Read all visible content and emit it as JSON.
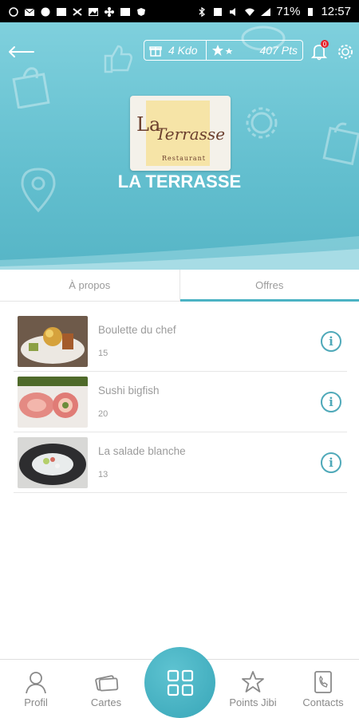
{
  "status_bar": {
    "battery": "71%",
    "time": "12:57"
  },
  "header": {
    "kdo": "4 Kdo",
    "points": "407 Pts",
    "notification_count": "0",
    "shop_name": "LA TERRASSE",
    "logo": {
      "line1": "La",
      "line2": "Terrasse",
      "line3": "Restaurant"
    },
    "accent_color": "#5fbfcf"
  },
  "tabs": [
    {
      "label": "À propos",
      "active": false
    },
    {
      "label": "Offres",
      "active": true
    }
  ],
  "offers": [
    {
      "title": "Boulette du chef",
      "count": "15"
    },
    {
      "title": "Sushi bigfish",
      "count": "20"
    },
    {
      "title": "La salade blanche",
      "count": "13"
    }
  ],
  "bottom_nav": [
    {
      "label": "Profil",
      "icon": "person-icon"
    },
    {
      "label": "Cartes",
      "icon": "cards-icon"
    },
    {
      "label": "",
      "icon": "grid-icon"
    },
    {
      "label": "Points Jibi",
      "icon": "star-icon"
    },
    {
      "label": "Contacts",
      "icon": "phone-book-icon"
    }
  ]
}
